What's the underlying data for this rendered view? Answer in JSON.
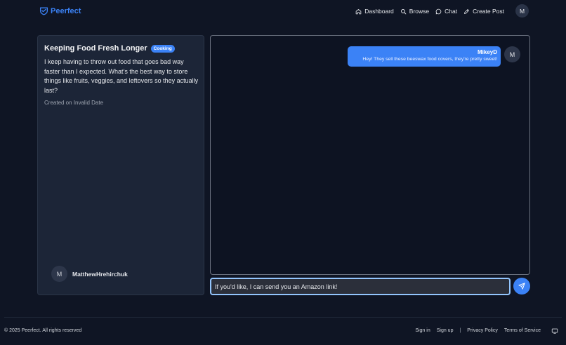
{
  "header": {
    "brand": "Peerfect",
    "nav": [
      {
        "label": "Dashboard",
        "icon": "home-icon"
      },
      {
        "label": "Browse",
        "icon": "search-icon"
      },
      {
        "label": "Chat",
        "icon": "chat-bubble-icon"
      },
      {
        "label": "Create Post",
        "icon": "pencil-icon"
      }
    ],
    "avatar_initial": "M"
  },
  "post": {
    "title": "Keeping Food Fresh Longer",
    "tag": "Cooking",
    "body": "I keep having to throw out food that goes bad way faster than I expected. What’s the best way to store things like fruits, veggies, and leftovers so they actually last?",
    "date": "Created on Invalid Date",
    "author": {
      "initial": "M",
      "name": "MatthewHrehirchuk"
    }
  },
  "chat": {
    "messages": [
      {
        "user": "MikeyD",
        "text": "Hey! They sell these beeswax food covers, they're pretty sweet!",
        "avatar_initial": "M"
      }
    ],
    "input_value": "If you'd like, I can send you an Amazon link!"
  },
  "footer": {
    "copyright": "© 2025 Peerfect. All rights reserved",
    "links": {
      "sign_in": "Sign in",
      "sign_up": "Sign up",
      "separator": "|",
      "privacy": "Privacy Policy",
      "terms": "Terms of Service"
    }
  },
  "colors": {
    "accent": "#3b82f6",
    "background": "#0f1524",
    "panel": "#1c2537"
  }
}
